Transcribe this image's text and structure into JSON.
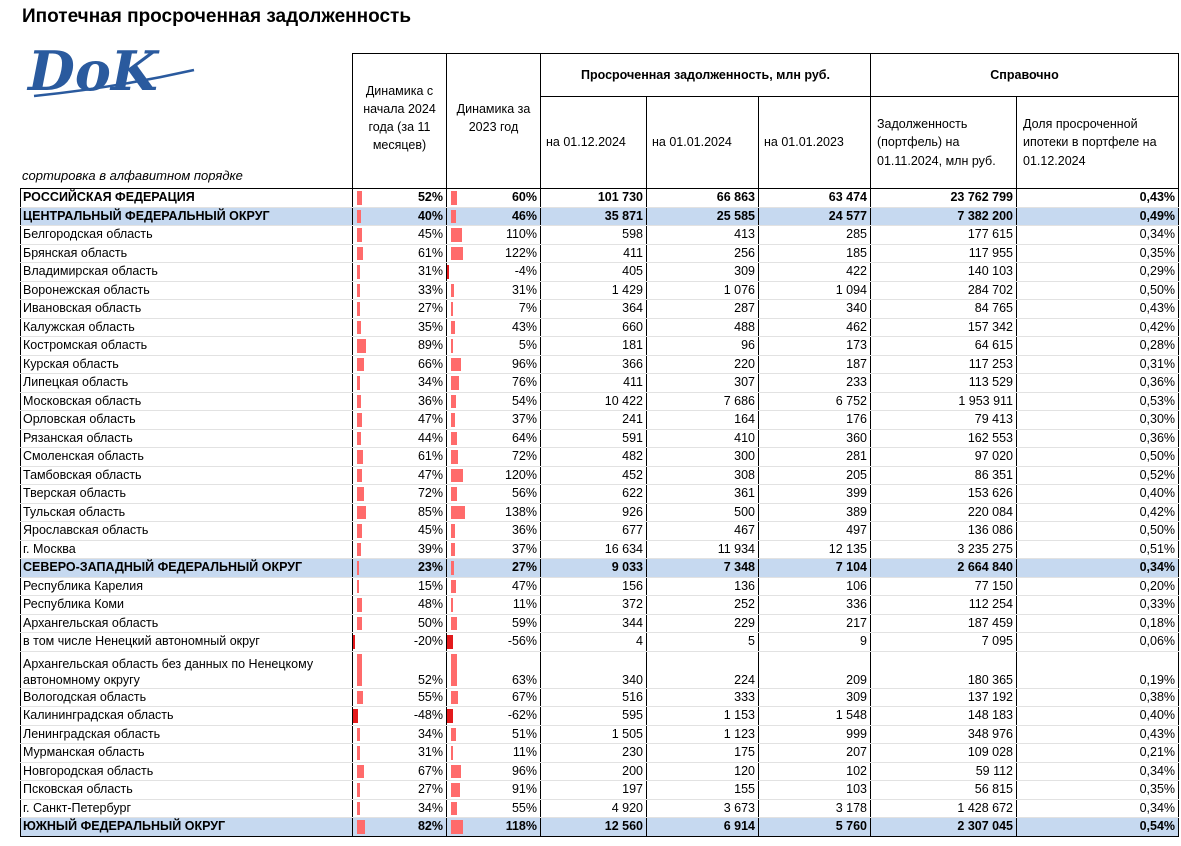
{
  "title": "Ипотечная просроченная задолженность",
  "logo_text": "DoK",
  "sort_note": "сортировка в алфавитном порядке",
  "headers": {
    "dyn_2024": "Динамика с начала 2024 года (за 11 месяцев)",
    "dyn_2023": "Динамика за 2023 год",
    "overdue_group": "Просроченная задолженность, млн руб.",
    "reference_group": "Справочно",
    "date_2024_12": "на 01.12.2024",
    "date_2024_01": "на 01.01.2024",
    "date_2023_01": "на 01.01.2023",
    "portfolio": "Задолженность (портфель) на 01.11.2024, млн руб.",
    "share": "Доля просроченной ипотеки в портфеле на 01.12.2024"
  },
  "bar_color": "#ff6b6b",
  "bar_neg_color": "#e31a1c",
  "highlight_color": "#c6d9f0",
  "rows": [
    {
      "name": "РОССИЙСКАЯ ФЕДЕРАЦИЯ",
      "type": "bold",
      "dyn_2024": "52%",
      "dyn_2024_v": 52,
      "dyn_2023": "60%",
      "dyn_2023_v": 60,
      "d1": "101 730",
      "d2": "66 863",
      "d3": "63 474",
      "portfolio": "23 762 799",
      "share": "0,43%"
    },
    {
      "name": "ЦЕНТРАЛЬНЫЙ ФЕДЕРАЛЬНЫЙ ОКРУГ",
      "type": "district",
      "dyn_2024": "40%",
      "dyn_2024_v": 40,
      "dyn_2023": "46%",
      "dyn_2023_v": 46,
      "d1": "35 871",
      "d2": "25 585",
      "d3": "24 577",
      "portfolio": "7 382 200",
      "share": "0,49%"
    },
    {
      "name": "Белгородская область",
      "dyn_2024": "45%",
      "dyn_2024_v": 45,
      "dyn_2023": "110%",
      "dyn_2023_v": 110,
      "d1": "598",
      "d2": "413",
      "d3": "285",
      "portfolio": "177 615",
      "share": "0,34%"
    },
    {
      "name": "Брянская область",
      "dyn_2024": "61%",
      "dyn_2024_v": 61,
      "dyn_2023": "122%",
      "dyn_2023_v": 122,
      "d1": "411",
      "d2": "256",
      "d3": "185",
      "portfolio": "117 955",
      "share": "0,35%"
    },
    {
      "name": "Владимирская область",
      "dyn_2024": "31%",
      "dyn_2024_v": 31,
      "dyn_2023": "-4%",
      "dyn_2023_v": -4,
      "d1": "405",
      "d2": "309",
      "d3": "422",
      "portfolio": "140 103",
      "share": "0,29%"
    },
    {
      "name": "Воронежская область",
      "dyn_2024": "33%",
      "dyn_2024_v": 33,
      "dyn_2023": "31%",
      "dyn_2023_v": 31,
      "d1": "1 429",
      "d2": "1 076",
      "d3": "1 094",
      "portfolio": "284 702",
      "share": "0,50%"
    },
    {
      "name": "Ивановская область",
      "dyn_2024": "27%",
      "dyn_2024_v": 27,
      "dyn_2023": "7%",
      "dyn_2023_v": 7,
      "d1": "364",
      "d2": "287",
      "d3": "340",
      "portfolio": "84 765",
      "share": "0,43%"
    },
    {
      "name": "Калужская область",
      "dyn_2024": "35%",
      "dyn_2024_v": 35,
      "dyn_2023": "43%",
      "dyn_2023_v": 43,
      "d1": "660",
      "d2": "488",
      "d3": "462",
      "portfolio": "157 342",
      "share": "0,42%"
    },
    {
      "name": "Костромская область",
      "dyn_2024": "89%",
      "dyn_2024_v": 89,
      "dyn_2023": "5%",
      "dyn_2023_v": 5,
      "d1": "181",
      "d2": "96",
      "d3": "173",
      "portfolio": "64 615",
      "share": "0,28%"
    },
    {
      "name": "Курская область",
      "dyn_2024": "66%",
      "dyn_2024_v": 66,
      "dyn_2023": "96%",
      "dyn_2023_v": 96,
      "d1": "366",
      "d2": "220",
      "d3": "187",
      "portfolio": "117 253",
      "share": "0,31%"
    },
    {
      "name": "Липецкая область",
      "dyn_2024": "34%",
      "dyn_2024_v": 34,
      "dyn_2023": "76%",
      "dyn_2023_v": 76,
      "d1": "411",
      "d2": "307",
      "d3": "233",
      "portfolio": "113 529",
      "share": "0,36%"
    },
    {
      "name": "Московская область",
      "dyn_2024": "36%",
      "dyn_2024_v": 36,
      "dyn_2023": "54%",
      "dyn_2023_v": 54,
      "d1": "10 422",
      "d2": "7 686",
      "d3": "6 752",
      "portfolio": "1 953 911",
      "share": "0,53%"
    },
    {
      "name": "Орловская область",
      "dyn_2024": "47%",
      "dyn_2024_v": 47,
      "dyn_2023": "37%",
      "dyn_2023_v": 37,
      "d1": "241",
      "d2": "164",
      "d3": "176",
      "portfolio": "79 413",
      "share": "0,30%"
    },
    {
      "name": "Рязанская область",
      "dyn_2024": "44%",
      "dyn_2024_v": 44,
      "dyn_2023": "64%",
      "dyn_2023_v": 64,
      "d1": "591",
      "d2": "410",
      "d3": "360",
      "portfolio": "162 553",
      "share": "0,36%"
    },
    {
      "name": "Смоленская область",
      "dyn_2024": "61%",
      "dyn_2024_v": 61,
      "dyn_2023": "72%",
      "dyn_2023_v": 72,
      "d1": "482",
      "d2": "300",
      "d3": "281",
      "portfolio": "97 020",
      "share": "0,50%"
    },
    {
      "name": "Тамбовская область",
      "dyn_2024": "47%",
      "dyn_2024_v": 47,
      "dyn_2023": "120%",
      "dyn_2023_v": 120,
      "d1": "452",
      "d2": "308",
      "d3": "205",
      "portfolio": "86 351",
      "share": "0,52%"
    },
    {
      "name": "Тверская область",
      "dyn_2024": "72%",
      "dyn_2024_v": 72,
      "dyn_2023": "56%",
      "dyn_2023_v": 56,
      "d1": "622",
      "d2": "361",
      "d3": "399",
      "portfolio": "153 626",
      "share": "0,40%"
    },
    {
      "name": "Тульская область",
      "dyn_2024": "85%",
      "dyn_2024_v": 85,
      "dyn_2023": "138%",
      "dyn_2023_v": 138,
      "d1": "926",
      "d2": "500",
      "d3": "389",
      "portfolio": "220 084",
      "share": "0,42%"
    },
    {
      "name": "Ярославская область",
      "dyn_2024": "45%",
      "dyn_2024_v": 45,
      "dyn_2023": "36%",
      "dyn_2023_v": 36,
      "d1": "677",
      "d2": "467",
      "d3": "497",
      "portfolio": "136 086",
      "share": "0,50%"
    },
    {
      "name": "г. Москва",
      "dyn_2024": "39%",
      "dyn_2024_v": 39,
      "dyn_2023": "37%",
      "dyn_2023_v": 37,
      "d1": "16 634",
      "d2": "11 934",
      "d3": "12 135",
      "portfolio": "3 235 275",
      "share": "0,51%"
    },
    {
      "name": "СЕВЕРО-ЗАПАДНЫЙ ФЕДЕРАЛЬНЫЙ ОКРУГ",
      "type": "district",
      "dyn_2024": "23%",
      "dyn_2024_v": 23,
      "dyn_2023": "27%",
      "dyn_2023_v": 27,
      "d1": "9 033",
      "d2": "7 348",
      "d3": "7 104",
      "portfolio": "2 664 840",
      "share": "0,34%"
    },
    {
      "name": "Республика Карелия",
      "dyn_2024": "15%",
      "dyn_2024_v": 15,
      "dyn_2023": "47%",
      "dyn_2023_v": 47,
      "d1": "156",
      "d2": "136",
      "d3": "106",
      "portfolio": "77 150",
      "share": "0,20%"
    },
    {
      "name": "Республика Коми",
      "dyn_2024": "48%",
      "dyn_2024_v": 48,
      "dyn_2023": "11%",
      "dyn_2023_v": 11,
      "d1": "372",
      "d2": "252",
      "d3": "336",
      "portfolio": "112 254",
      "share": "0,33%"
    },
    {
      "name": "Архангельская область",
      "dyn_2024": "50%",
      "dyn_2024_v": 50,
      "dyn_2023": "59%",
      "dyn_2023_v": 59,
      "d1": "344",
      "d2": "229",
      "d3": "217",
      "portfolio": "187 459",
      "share": "0,18%"
    },
    {
      "name": "в том числе Ненецкий автономный округ",
      "dyn_2024": "-20%",
      "dyn_2024_v": -20,
      "dyn_2023": "-56%",
      "dyn_2023_v": -56,
      "d1": "4",
      "d2": "5",
      "d3": "9",
      "portfolio": "7 095",
      "share": "0,06%"
    },
    {
      "name": "Архангельская область без данных по Ненецкому автономному округу",
      "type": "tall",
      "dyn_2024": "52%",
      "dyn_2024_v": 52,
      "dyn_2023": "63%",
      "dyn_2023_v": 63,
      "d1": "340",
      "d2": "224",
      "d3": "209",
      "portfolio": "180 365",
      "share": "0,19%"
    },
    {
      "name": "Вологодская область",
      "dyn_2024": "55%",
      "dyn_2024_v": 55,
      "dyn_2023": "67%",
      "dyn_2023_v": 67,
      "d1": "516",
      "d2": "333",
      "d3": "309",
      "portfolio": "137 192",
      "share": "0,38%"
    },
    {
      "name": "Калининградская область",
      "dyn_2024": "-48%",
      "dyn_2024_v": -48,
      "dyn_2023": "-62%",
      "dyn_2023_v": -62,
      "d1": "595",
      "d2": "1 153",
      "d3": "1 548",
      "portfolio": "148 183",
      "share": "0,40%"
    },
    {
      "name": "Ленинградская область",
      "dyn_2024": "34%",
      "dyn_2024_v": 34,
      "dyn_2023": "51%",
      "dyn_2023_v": 51,
      "d1": "1 505",
      "d2": "1 123",
      "d3": "999",
      "portfolio": "348 976",
      "share": "0,43%"
    },
    {
      "name": "Мурманская область",
      "dyn_2024": "31%",
      "dyn_2024_v": 31,
      "dyn_2023": "11%",
      "dyn_2023_v": 11,
      "d1": "230",
      "d2": "175",
      "d3": "207",
      "portfolio": "109 028",
      "share": "0,21%"
    },
    {
      "name": "Новгородская область",
      "dyn_2024": "67%",
      "dyn_2024_v": 67,
      "dyn_2023": "96%",
      "dyn_2023_v": 96,
      "d1": "200",
      "d2": "120",
      "d3": "102",
      "portfolio": "59 112",
      "share": "0,34%"
    },
    {
      "name": "Псковская область",
      "dyn_2024": "27%",
      "dyn_2024_v": 27,
      "dyn_2023": "91%",
      "dyn_2023_v": 91,
      "d1": "197",
      "d2": "155",
      "d3": "103",
      "portfolio": "56 815",
      "share": "0,35%"
    },
    {
      "name": "г. Санкт-Петербург",
      "dyn_2024": "34%",
      "dyn_2024_v": 34,
      "dyn_2023": "55%",
      "dyn_2023_v": 55,
      "d1": "4 920",
      "d2": "3 673",
      "d3": "3 178",
      "portfolio": "1 428 672",
      "share": "0,34%"
    },
    {
      "name": "ЮЖНЫЙ ФЕДЕРАЛЬНЫЙ ОКРУГ",
      "type": "district",
      "dyn_2024": "82%",
      "dyn_2024_v": 82,
      "dyn_2023": "118%",
      "dyn_2023_v": 118,
      "d1": "12 560",
      "d2": "6 914",
      "d3": "5 760",
      "portfolio": "2 307 045",
      "share": "0,54%"
    }
  ]
}
